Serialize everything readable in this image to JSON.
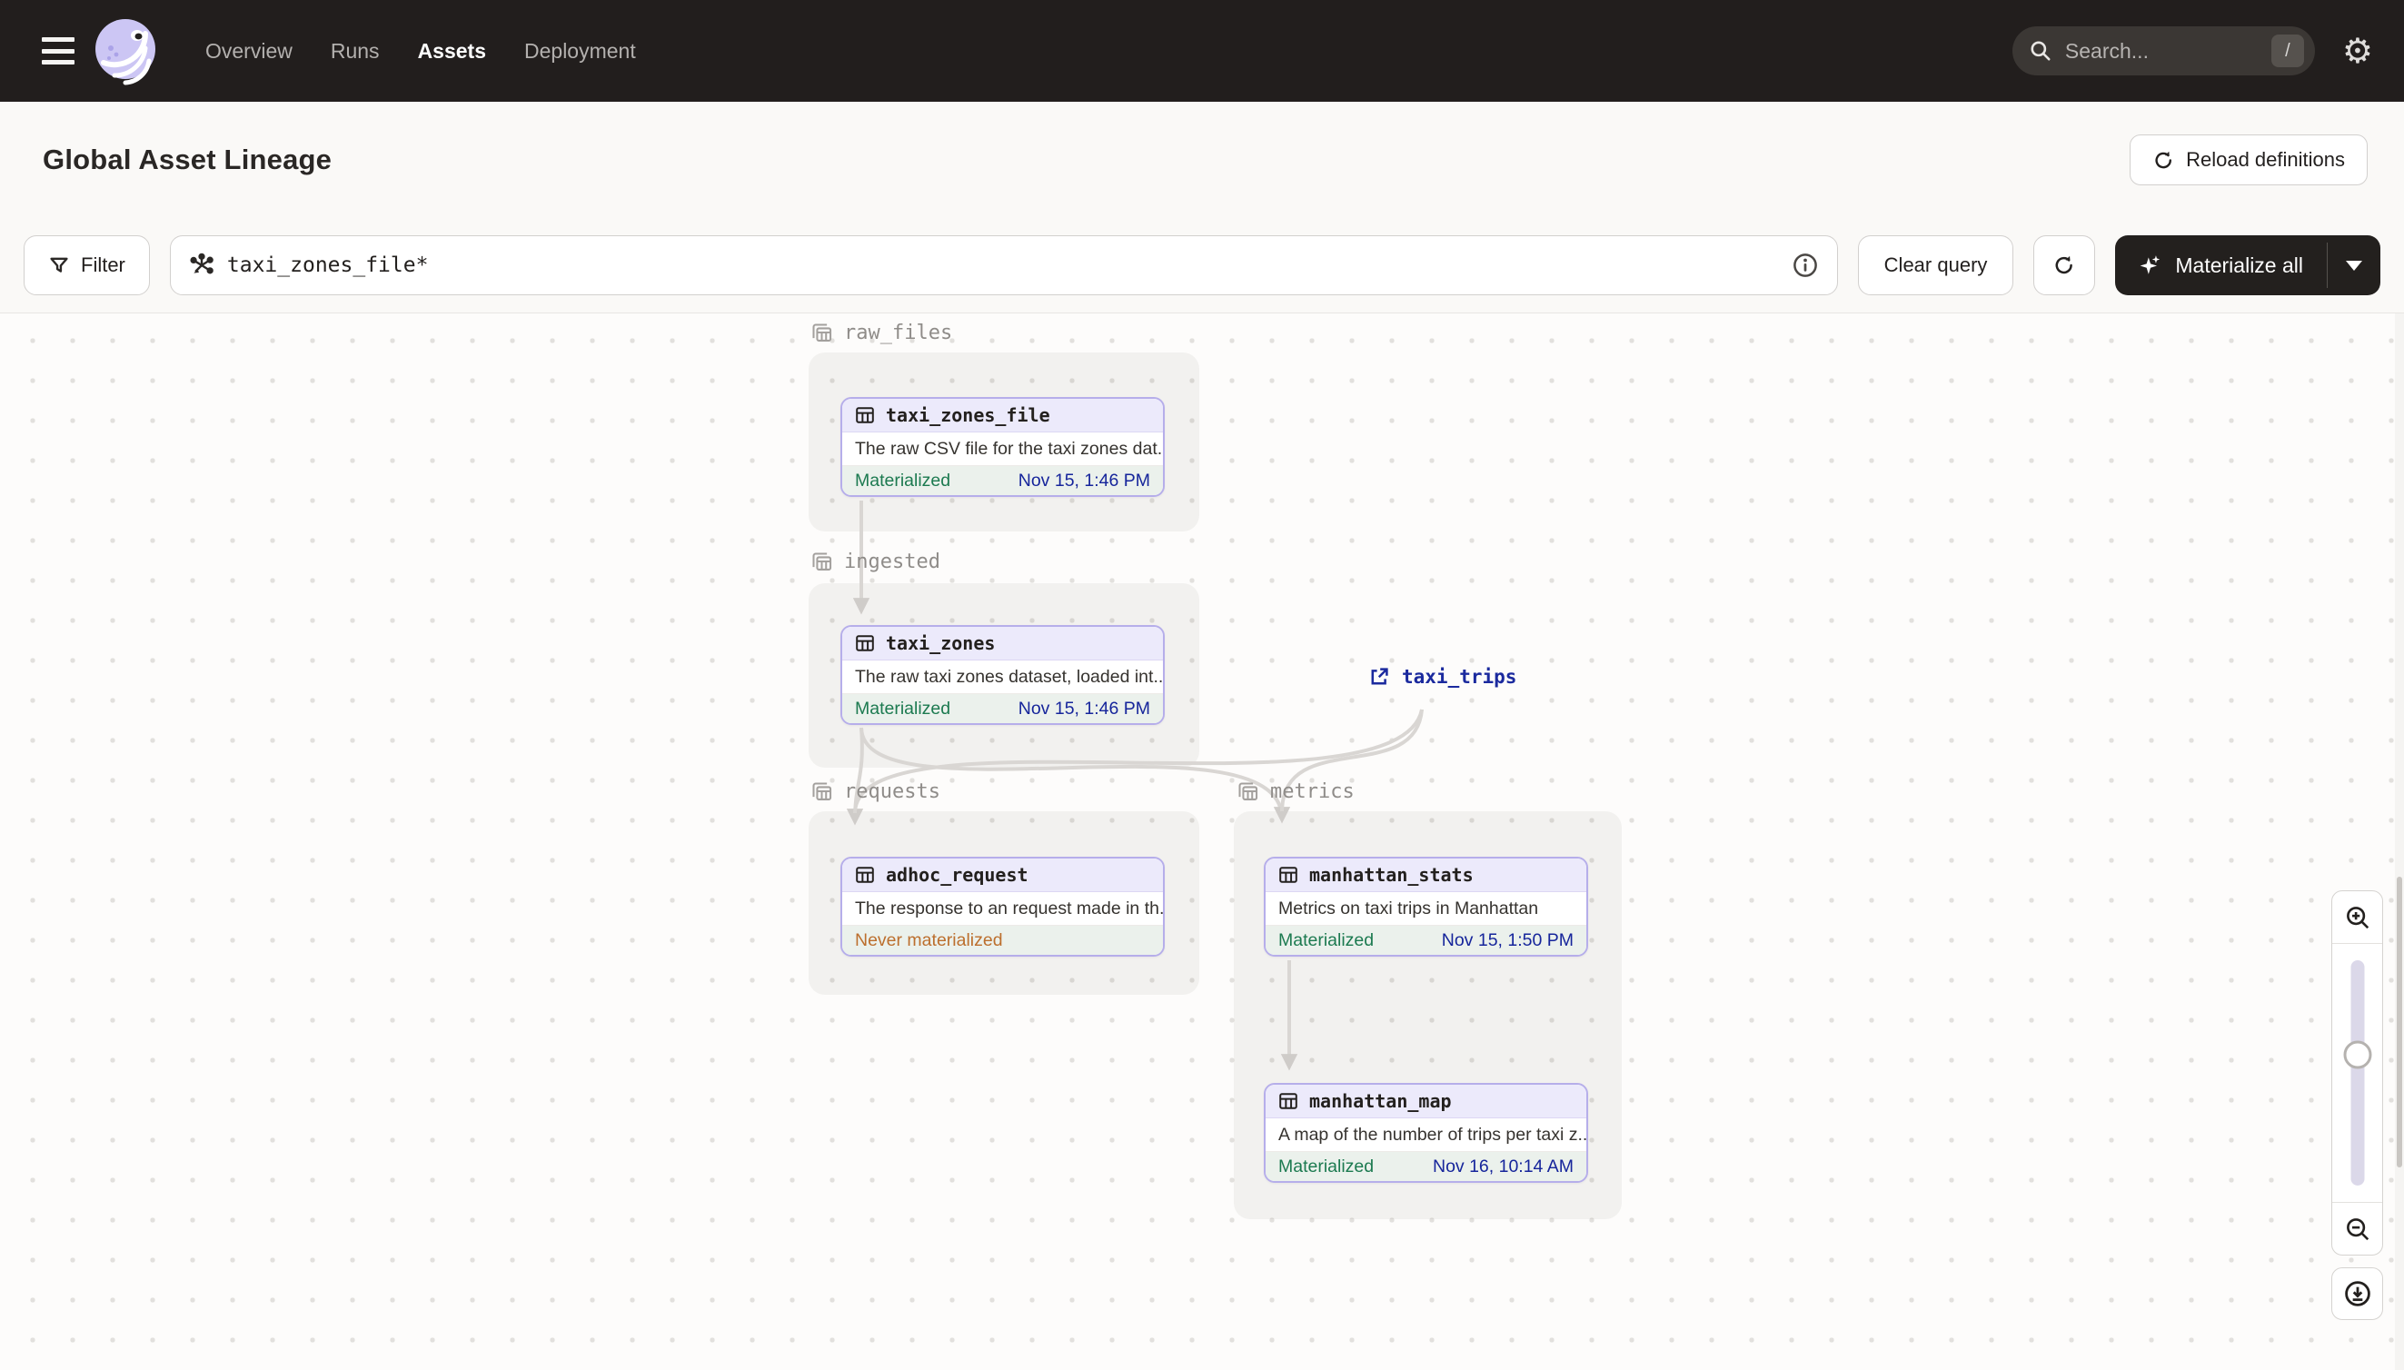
{
  "nav": {
    "items": [
      {
        "label": "Overview",
        "active": false
      },
      {
        "label": "Runs",
        "active": false
      },
      {
        "label": "Assets",
        "active": true
      },
      {
        "label": "Deployment",
        "active": false
      }
    ],
    "search_placeholder": "Search...",
    "search_shortcut": "/"
  },
  "header": {
    "title": "Global Asset Lineage",
    "reload_button": "Reload definitions"
  },
  "toolbar": {
    "filter_label": "Filter",
    "query_value": "taxi_zones_file*",
    "clear_button": "Clear query",
    "materialize_button": "Materialize all"
  },
  "graph": {
    "groups": [
      {
        "name": "raw_files"
      },
      {
        "name": "ingested"
      },
      {
        "name": "requests"
      },
      {
        "name": "metrics"
      }
    ],
    "nodes": [
      {
        "name": "taxi_zones_file",
        "description": "The raw CSV file for the taxi zones dat...",
        "status": "Materialized",
        "timestamp": "Nov 15, 1:46 PM"
      },
      {
        "name": "taxi_zones",
        "description": "The raw taxi zones dataset, loaded int...",
        "status": "Materialized",
        "timestamp": "Nov 15, 1:46 PM"
      },
      {
        "name": "adhoc_request",
        "description": "The response to an request made in th...",
        "status": "Never materialized",
        "timestamp": ""
      },
      {
        "name": "manhattan_stats",
        "description": "Metrics on taxi trips in Manhattan",
        "status": "Materialized",
        "timestamp": "Nov 15, 1:50 PM"
      },
      {
        "name": "manhattan_map",
        "description": "A map of the number of trips per taxi z...",
        "status": "Materialized",
        "timestamp": "Nov 16, 10:14 AM"
      }
    ],
    "external_asset": {
      "name": "taxi_trips"
    }
  },
  "icons": {
    "menu": "hamburger",
    "logo": "dagster-octopus",
    "search": "magnifier",
    "settings": "gear",
    "reload": "circular-arrow",
    "filter": "funnel",
    "query": "lineage-asterisk",
    "info": "circled-i",
    "materialize": "sparkle",
    "asset": "table-grid",
    "group": "stacked-tables",
    "external": "arrow-out-of-box",
    "zoom_in": "magnifier-plus",
    "zoom_out": "magnifier-minus",
    "export": "circled-download-arrow"
  },
  "colors": {
    "nav_bg": "#221e1d",
    "page_bg": "#faf9f7",
    "accent_purple": "#b6aeea",
    "node_header": "#eceafb",
    "materialized_green": "#1c7a50",
    "never_materialized_orange": "#bc6f2e",
    "timestamp_navy": "#16259b",
    "external_navy": "#1b2a9e",
    "edge_gray": "#d9d6d3"
  }
}
